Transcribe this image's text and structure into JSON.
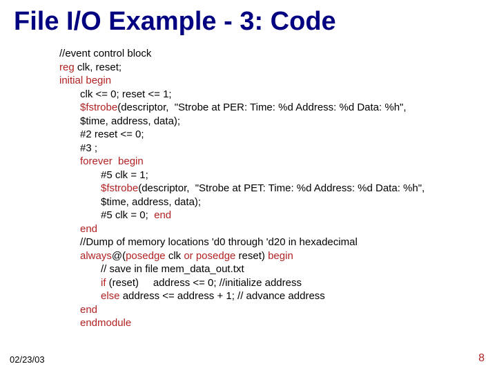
{
  "title": "File I/O Example - 3: Code",
  "date": "02/23/03",
  "pagenum": "8",
  "code": {
    "l0a": "//event control block",
    "l0b_pre": "",
    "l0b_kw": "reg",
    "l0b_post": " clk, reset;",
    "l0c_kw": "initial begin",
    "l1a": "clk <= 0; reset <= 1;",
    "l1b_pre": "",
    "l1b_kw": "$fstrobe",
    "l1b_post": "(descriptor,  \"Strobe at PER: Time: %d Address: %d Data: %h\",",
    "l1c": "$time, address, data);",
    "l1d": "#2 reset <= 0;",
    "l1e": "#3 ;",
    "l1f_kw": "forever  begin",
    "l2a": "#5 clk = 1;",
    "l2b_pre": "",
    "l2b_kw": "$fstrobe",
    "l2b_post": "(descriptor,  \"Strobe at PET: Time: %d Address: %d Data: %h\",",
    "l2c": "$time, address, data);",
    "l2d_pre": "#5 clk = 0;  ",
    "l2d_kw": "end",
    "l1g_kw": "end",
    "l1h": "//Dump of memory locations 'd0 through 'd20 in hexadecimal",
    "l1i_kw1": "always",
    "l1i_mid1": "@(",
    "l1i_kw2": "posedge",
    "l1i_mid2": " clk ",
    "l1i_kw3": "or posedge",
    "l1i_mid3": " reset) ",
    "l1i_kw4": "begin",
    "l2e": "// save in file mem_data_out.txt",
    "l2f_kw": "if",
    "l2f_post": " (reset)     address <= 0; //initialize address",
    "l2g_kw": "else",
    "l2g_post": " address <= address + 1; // advance address",
    "l1j_kw": "end",
    "l1k_kw": "endmodule"
  }
}
